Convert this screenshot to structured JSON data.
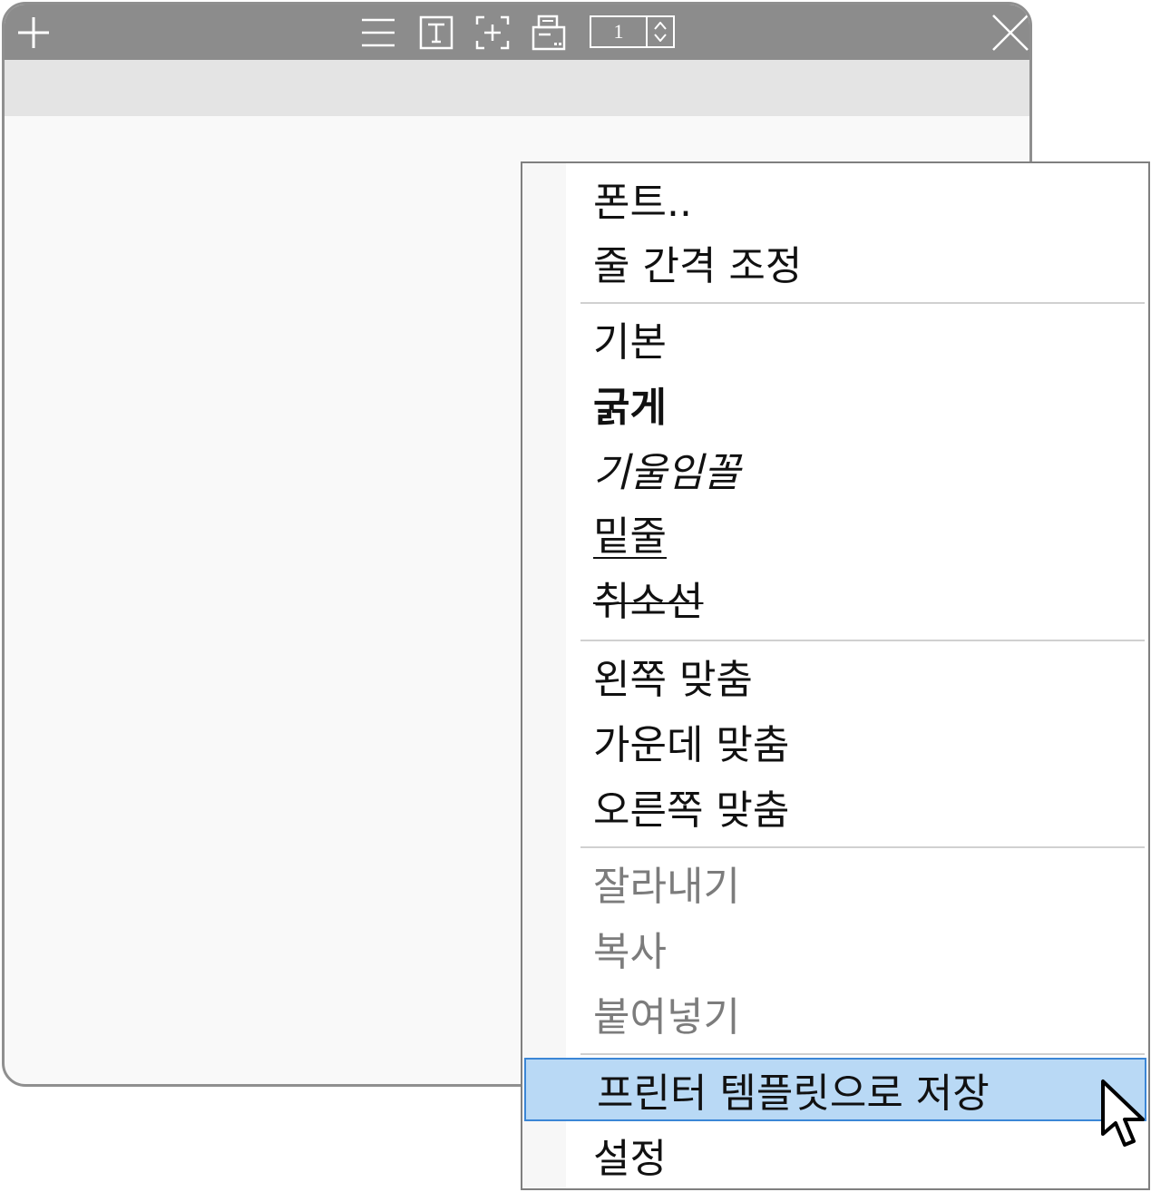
{
  "toolbar": {
    "add_icon": "plus-icon",
    "icons": [
      "hamburger-menu-icon",
      "text-box-icon",
      "add-frame-icon",
      "printer-icon",
      "close-icon"
    ],
    "page_number": "1"
  },
  "context_menu": {
    "groups": [
      [
        "폰트..",
        "줄 간격 조정"
      ],
      [
        "기본",
        "굵게",
        "기울임꼴",
        "밑줄",
        "취소선"
      ],
      [
        "왼쪽 맞춤",
        "가운데 맞춤",
        "오른쪽 맞춤"
      ],
      [
        "잘라내기",
        "복사",
        "붙여넣기"
      ],
      [
        "프린터 템플릿으로 저장",
        "설정"
      ]
    ],
    "items": {
      "font": "폰트..",
      "line_spacing": "줄 간격 조정",
      "normal": "기본",
      "bold": "굵게",
      "italic": "기울임꼴",
      "underline": "밑줄",
      "strikethrough": "취소선",
      "align_left": "왼쪽 맞춤",
      "align_center": "가운데 맞춤",
      "align_right": "오른쪽 맞춤",
      "cut": "잘라내기",
      "copy": "복사",
      "paste": "붙여넣기",
      "save_template": "프린터 템플릿으로 저장",
      "settings": "설정"
    },
    "disabled": [
      "잘라내기",
      "복사",
      "붙여넣기"
    ],
    "highlighted": "프린터 템플릿으로 저장"
  },
  "colors": {
    "titlebar": "#8c8c8c",
    "highlight": "#b9d9f5",
    "highlight_border": "#3b86d6",
    "disabled_text": "#7c7c7c"
  }
}
